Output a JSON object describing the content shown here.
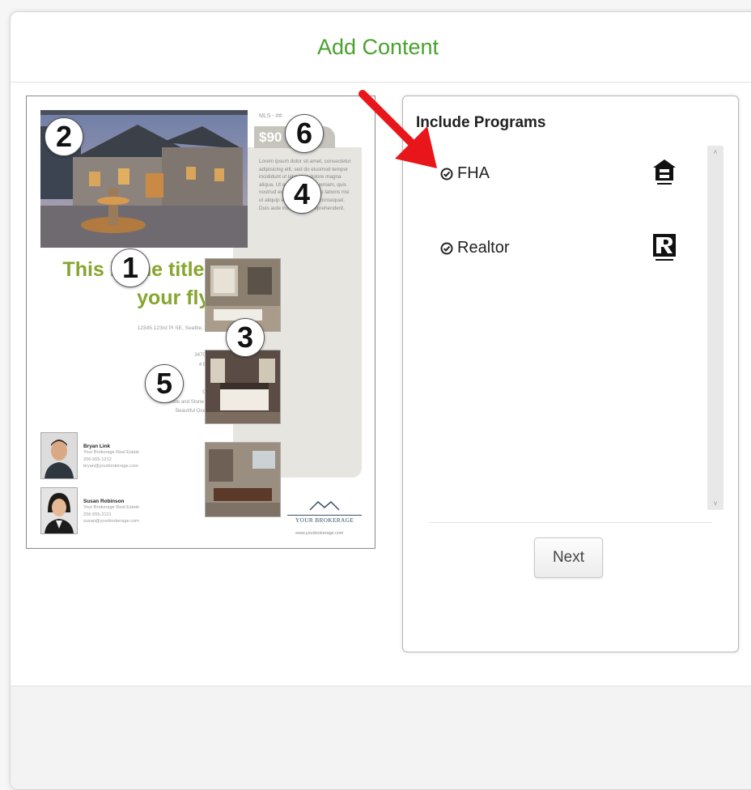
{
  "dialog": {
    "title": "Add Content"
  },
  "flyer": {
    "mls": "MLS - ##",
    "price": "$90",
    "title": "This is the title of your flyer",
    "address": "12345 123rd Pl SE, Seattle, WA 98000",
    "description": "Lorem ipsum dolor sit amet, consectetur adipisicing elit, sed do eiusmod tempor incididunt ut labore et dolore magna aliqua. Ut enim ad minim veniam, quis nostrud exercitation ullamco laboris nisi ut aliquip ex ea commodo consequat. Duis aute irure dolor in reprehenderit.",
    "features": [
      "3470 Sq. Feet •",
      "4 Bedrooms •",
      "3 Baths •",
      "Sunroom •",
      "Central Air •",
      "Concrete and Stone Driveway •",
      "Beautiful Ocean Views •"
    ],
    "agents": [
      {
        "name": "Bryan Link",
        "company": "Your Brokerage Real Estate",
        "phone": "206-555-1212",
        "email": "bryan@yourbrokerage.com"
      },
      {
        "name": "Susan Robinson",
        "company": "Your Brokerage Real Estate",
        "phone": "206-555-2121",
        "email": "susan@yourbrokerage.com"
      }
    ],
    "brokerage_name": "YOUR BROKERAGE",
    "brokerage_url": "www.yourbrokerage.com",
    "badges": [
      "1",
      "2",
      "3",
      "4",
      "5",
      "6"
    ]
  },
  "panel": {
    "title": "Include Programs",
    "programs": [
      {
        "label": "FHA",
        "checked": true,
        "logo": "equal-housing-icon"
      },
      {
        "label": "Realtor",
        "checked": true,
        "logo": "realtor-icon"
      }
    ],
    "next_label": "Next"
  },
  "colors": {
    "accent_green": "#4aa12f",
    "flyer_title_green": "#87a52f",
    "arrow_red": "#e8161b"
  }
}
